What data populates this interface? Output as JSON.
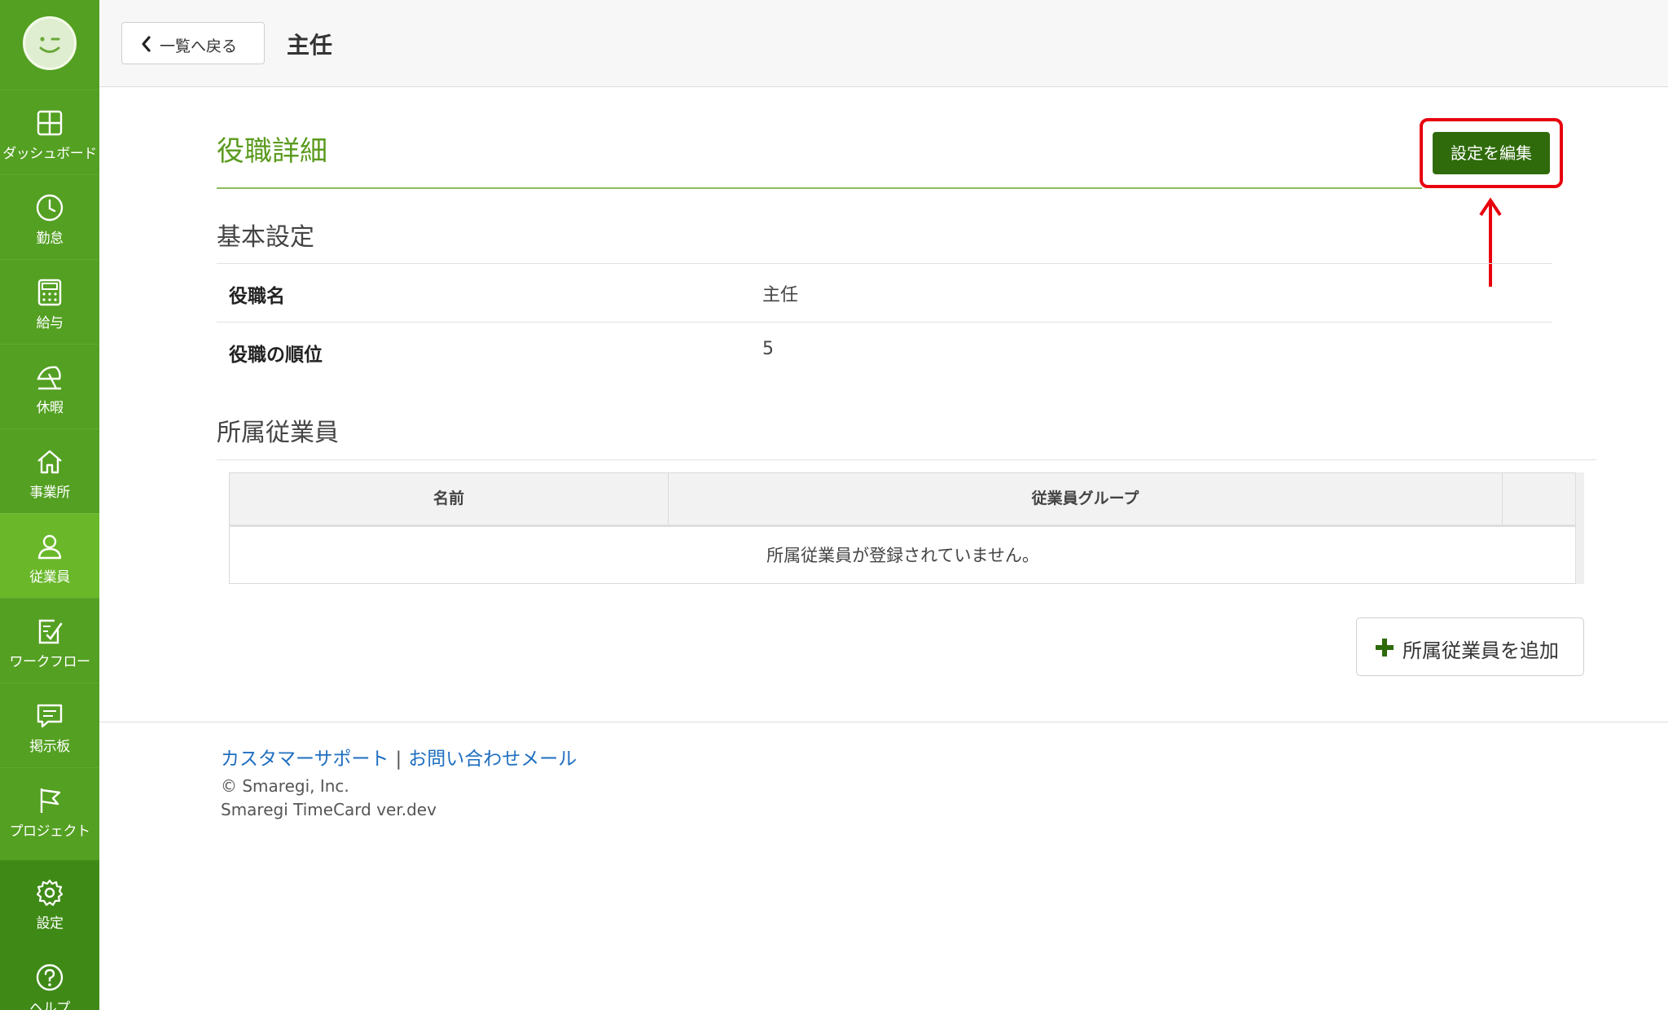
{
  "sidebar": {
    "items": [
      {
        "label": "ダッシュボード",
        "icon": "dashboard-icon",
        "active": false
      },
      {
        "label": "勤怠",
        "icon": "clock-icon",
        "active": false
      },
      {
        "label": "給与",
        "icon": "calculator-icon",
        "active": false
      },
      {
        "label": "休暇",
        "icon": "beach-umbrella-icon",
        "active": false
      },
      {
        "label": "事業所",
        "icon": "home-icon",
        "active": false
      },
      {
        "label": "従業員",
        "icon": "user-icon",
        "active": true
      },
      {
        "label": "ワークフロー",
        "icon": "checklist-icon",
        "active": false
      },
      {
        "label": "掲示板",
        "icon": "chat-icon",
        "active": false
      },
      {
        "label": "プロジェクト",
        "icon": "flag-icon",
        "active": false
      }
    ],
    "bottom_items": [
      {
        "label": "設定",
        "icon": "gear-icon"
      },
      {
        "label": "ヘルプ",
        "icon": "help-icon"
      }
    ]
  },
  "header": {
    "back_label": "一覧へ戻る",
    "title": "主任"
  },
  "main": {
    "section_title": "役職詳細",
    "edit_button": "設定を編集",
    "basic": {
      "heading": "基本設定",
      "rows": [
        {
          "label": "役職名",
          "value": "主任"
        },
        {
          "label": "役職の順位",
          "value": "5"
        }
      ]
    },
    "members": {
      "heading": "所属従業員",
      "columns": [
        "名前",
        "従業員グループ",
        ""
      ],
      "empty_message": "所属従業員が登録されていません。",
      "add_button": "所属従業員を追加"
    }
  },
  "footer": {
    "link_support": "カスタマーサポート",
    "separator": "|",
    "link_mail": "お問い合わせメール",
    "copyright": "© Smaregi, Inc.",
    "version": "Smaregi TimeCard ver.dev"
  },
  "colors": {
    "sidebar": "#54a022",
    "sidebar_active": "#6ab82a",
    "accent_green": "#5a9a1e",
    "edit_button": "#2f6b0b",
    "highlight_red": "#e8000e",
    "link_blue": "#1f6fc0"
  }
}
